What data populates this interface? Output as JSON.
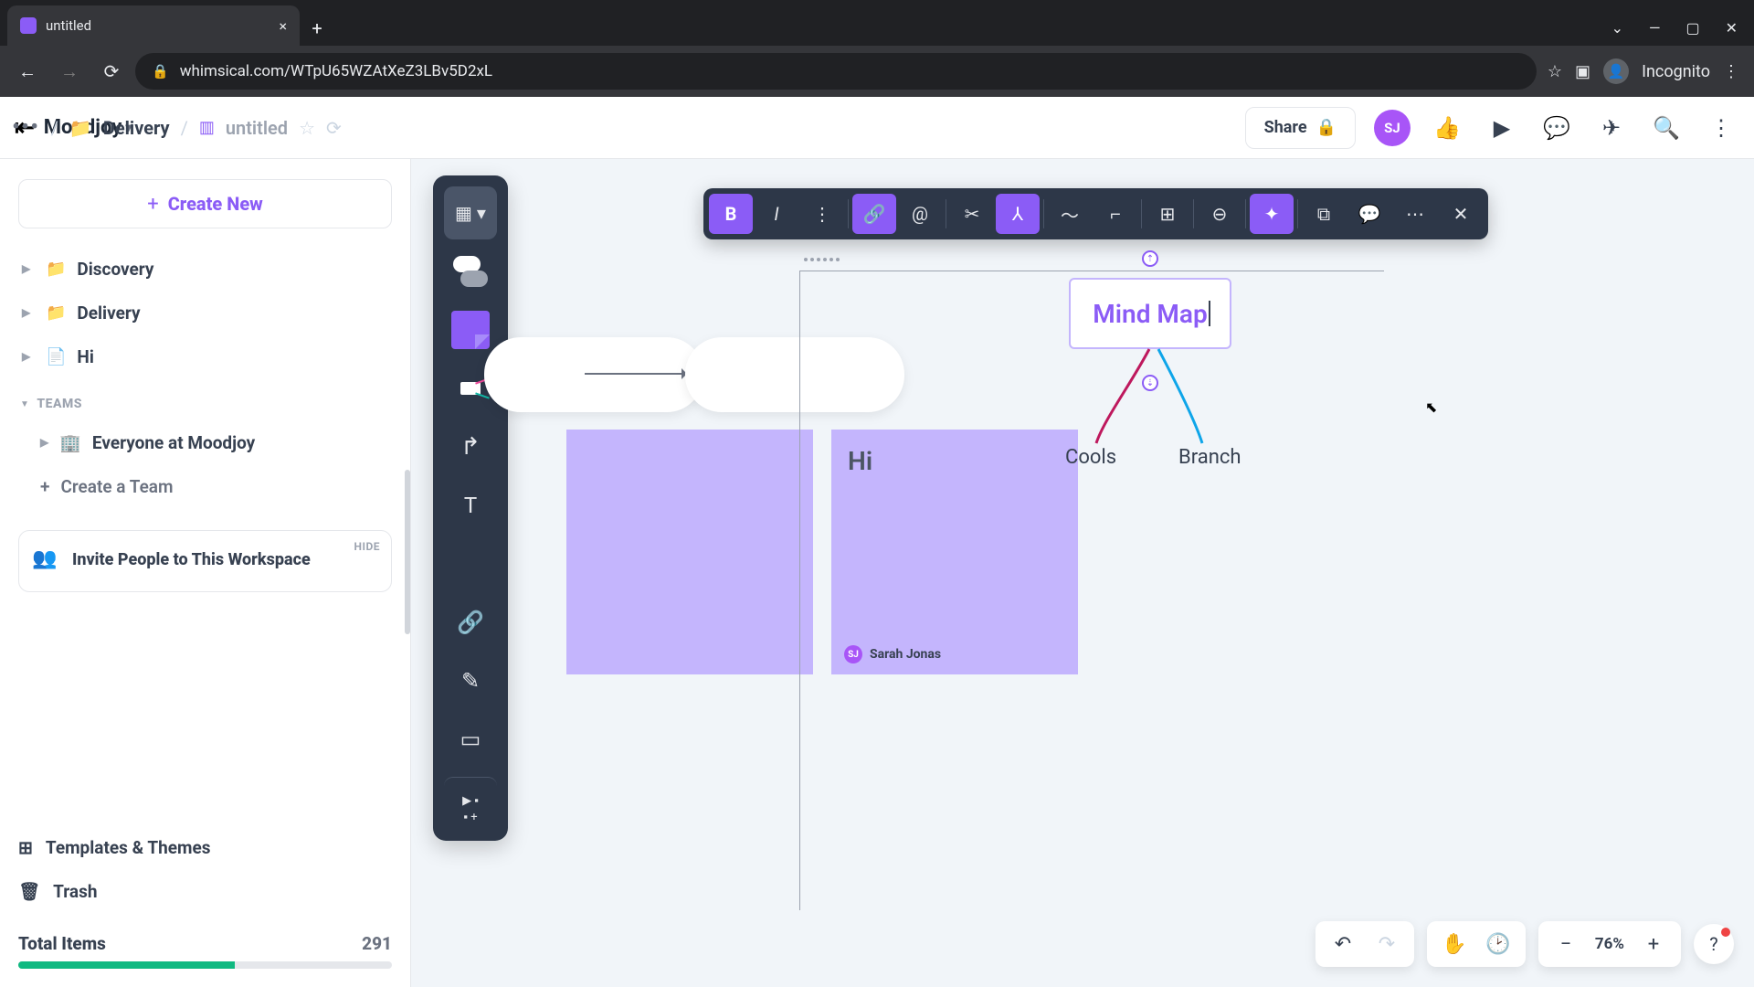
{
  "browser": {
    "tab_title": "untitled",
    "url": "whimsical.com/WTpU65WZAtXeZ3LBv5D2xL",
    "incognito_label": "Incognito"
  },
  "topbar": {
    "workspace": "Moodjoy",
    "breadcrumb_parent": "Delivery",
    "doc_title": "untitled",
    "share": "Share",
    "avatar_initials": "SJ"
  },
  "sidebar": {
    "create": "Create New",
    "items": [
      {
        "label": "Discovery"
      },
      {
        "label": "Delivery"
      },
      {
        "label": "Hi"
      }
    ],
    "teams_label": "TEAMS",
    "team_everyone": "Everyone at Moodjoy",
    "create_team": "Create a Team",
    "invite_text": "Invite People to This Workspace",
    "hide": "HIDE",
    "templates": "Templates & Themes",
    "trash": "Trash",
    "total_label": "Total Items",
    "total_value": "291"
  },
  "canvas": {
    "mind_root": "Mind Map",
    "branch1": "Cools",
    "branch2": "Branch",
    "note_text": "Hi",
    "author": "Sarah Jonas",
    "zoom": "76%"
  }
}
